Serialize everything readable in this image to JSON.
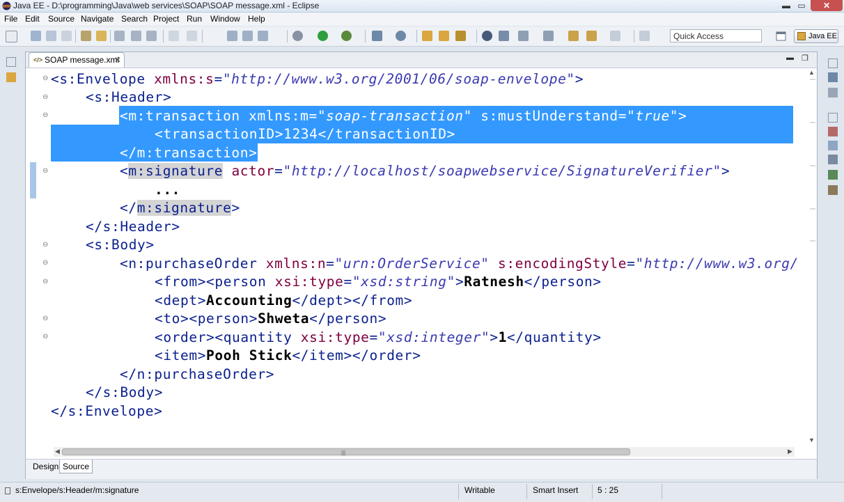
{
  "window": {
    "title": "Java EE - D:\\programming\\Java\\web services\\SOAP\\SOAP message.xml - Eclipse",
    "minimize": "▬",
    "maximize": "▭",
    "close": "✕"
  },
  "menu": [
    "File",
    "Edit",
    "Source",
    "Navigate",
    "Search",
    "Project",
    "Run",
    "Window",
    "Help"
  ],
  "toolbar": {
    "quick_access": "Quick Access",
    "perspective": "Java EE"
  },
  "editor": {
    "tab_label": "SOAP message.xml",
    "tab_close": "✕",
    "min": "▬",
    "max": "❐",
    "lines": {
      "l1": {
        "a": "<s:Envelope ",
        "b": "xmlns:s",
        "c": "=",
        "d": "\"http://www.w3.org/2001/06/soap-envelope\"",
        "e": ">"
      },
      "l2": {
        "a": "<s:Header>"
      },
      "l3": {
        "a": "<m:transaction ",
        "b": "xmlns:m",
        "c": "=",
        "d": "\"soap-transaction\"",
        "e": " s:mustUnderstand",
        "f": "=",
        "g": "\"true\"",
        "h": ">"
      },
      "l4": {
        "a": "<transactionID>1234</transactionID>"
      },
      "l5": {
        "a": "</m:transaction>"
      },
      "l6": {
        "a": "<",
        "b": "m:signature",
        "c": " ",
        "d": "actor",
        "e": "=",
        "f": "\"http://localhost/soapwebservice/SignatureVerifier\"",
        "g": ">"
      },
      "l7": {
        "a": "..."
      },
      "l8": {
        "a": "</",
        "b": "m:signature",
        "c": ">"
      },
      "l9": {
        "a": "</s:Header>"
      },
      "l10": {
        "a": "<s:Body>"
      },
      "l11": {
        "a": "<n:purchaseOrder ",
        "b": "xmlns:n",
        "c": "=",
        "d": "\"urn:OrderService\"",
        "e": " s:encodingStyle",
        "f": "=",
        "g": "\"http://www.w3.org/"
      },
      "l12": {
        "a": "<from><person ",
        "b": "xsi:type",
        "c": "=",
        "d": "\"xsd:string\"",
        "e": ">",
        "f": "Ratnesh",
        "g": "</person>"
      },
      "l13": {
        "a": "<dept>",
        "b": "Accounting",
        "c": "</dept></from>"
      },
      "l14": {
        "a": "<to><person>",
        "b": "Shweta",
        "c": "</person>"
      },
      "l15": {
        "a": "<order><quantity ",
        "b": "xsi:type",
        "c": "=",
        "d": "\"xsd:integer\"",
        "e": ">",
        "f": "1",
        "g": "</quantity>"
      },
      "l16": {
        "a": "<item>",
        "b": "Pooh Stick",
        "c": "</item></order>"
      },
      "l17": {
        "a": "</n:purchaseOrder>"
      },
      "l18": {
        "a": "</s:Body>"
      },
      "l19": {
        "a": "</s:Envelope>"
      }
    },
    "fold_glyph": "⊖",
    "bottom_tabs": {
      "design": "Design",
      "source": "Source"
    }
  },
  "status": {
    "path": "s:Envelope/s:Header/m:signature",
    "writable": "Writable",
    "insert_mode": "Smart Insert",
    "position": "5 : 25"
  },
  "colors": {
    "selection": "#3399ff",
    "markup": "#0a1f8e",
    "attribute": "#800040",
    "value": "#3a3ab0"
  }
}
